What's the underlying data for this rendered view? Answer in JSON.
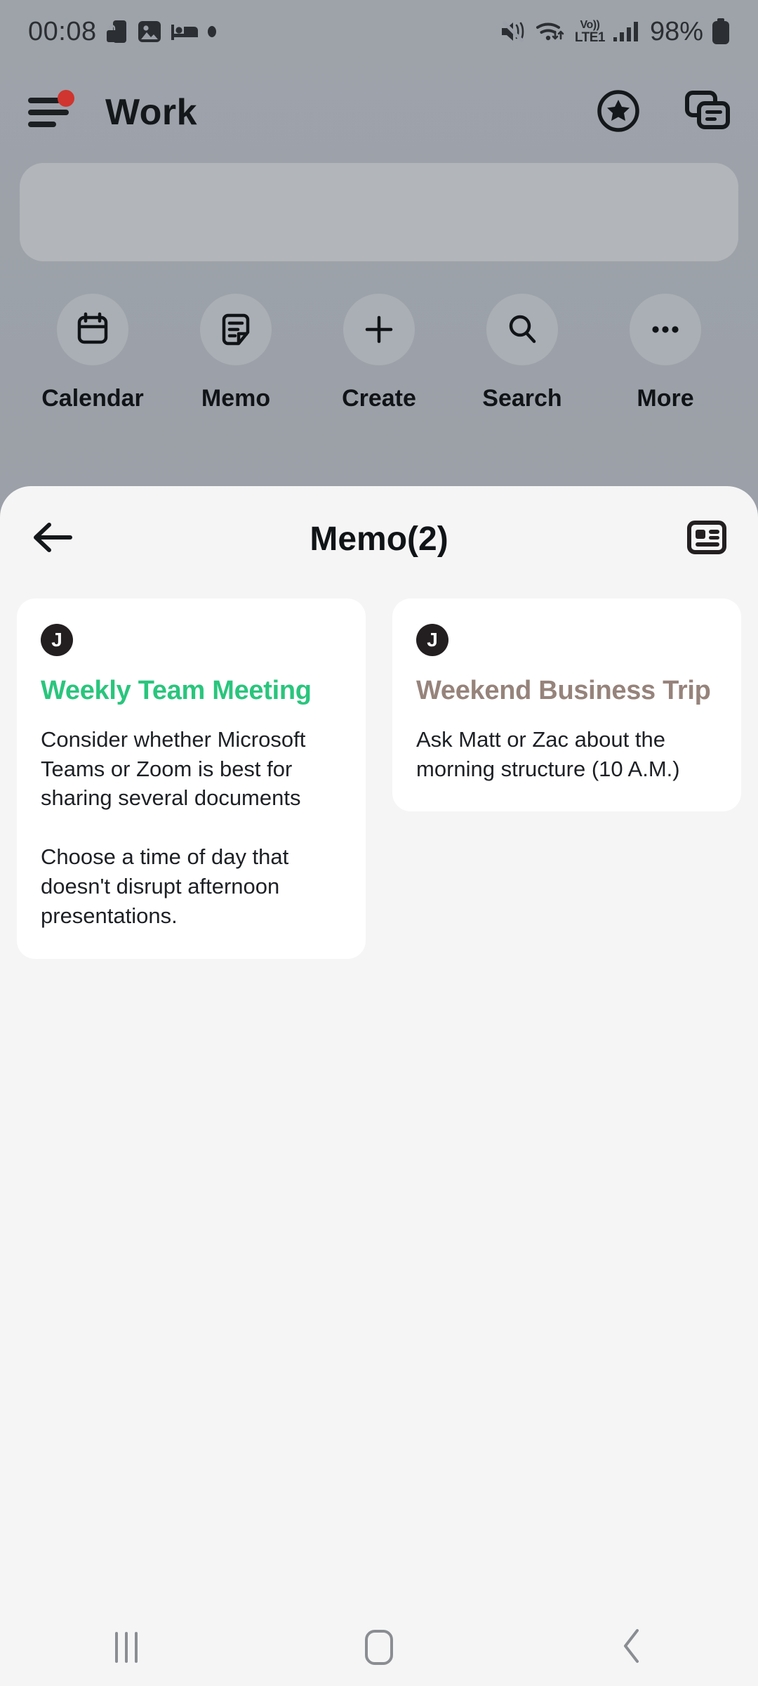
{
  "status_bar": {
    "time": "00:08",
    "left_icons": [
      "phone-lock-icon",
      "gallery-icon",
      "bed-icon",
      "dot-icon"
    ],
    "mute_icon": "mute-icon",
    "wifi_icon": "wifi-icon",
    "network_line1": "Vo))",
    "network_line2": "LTE1",
    "signal_icon": "signal-bars-icon",
    "battery_percent": "98%",
    "battery_icon": "battery-icon"
  },
  "app_header": {
    "title": "Work",
    "menu_icon": "hamburger-menu-icon",
    "menu_has_badge": true,
    "favorites_icon": "star-circle-icon",
    "cards_icon": "stacked-cards-icon"
  },
  "search_card": {
    "placeholder": ""
  },
  "quick_actions": [
    {
      "label": "Calendar",
      "icon": "calendar-icon"
    },
    {
      "label": "Memo",
      "icon": "memo-note-icon"
    },
    {
      "label": "Create",
      "icon": "plus-icon"
    },
    {
      "label": "Search",
      "icon": "search-icon"
    },
    {
      "label": "More",
      "icon": "ellipsis-icon"
    }
  ],
  "memo_sheet": {
    "title": "Memo(2)",
    "back_icon": "back-arrow-icon",
    "view_toggle_icon": "list-view-icon",
    "colors": {
      "title_green": "#2ac57d",
      "title_taupe": "#96837b",
      "avatar_bg": "#231f20",
      "card_bg": "#ffffff",
      "sheet_bg": "#f5f5f6"
    },
    "memos": [
      {
        "avatar": "J",
        "title": "Weekly Team Meeting",
        "title_color": "#2ac57d",
        "body": "Consider whether Microsoft Teams or Zoom is best for sharing several documents\n\nChoose a time of day that doesn't disrupt afternoon presentations."
      },
      {
        "avatar": "J",
        "title": "Weekend Business Trip",
        "title_color": "#96837b",
        "body": "Ask Matt or Zac about the morning structure (10 A.M.)"
      }
    ]
  },
  "nav_bar": {
    "recents_label": "recents-icon",
    "home_label": "home-icon",
    "back_label": "back-icon"
  }
}
